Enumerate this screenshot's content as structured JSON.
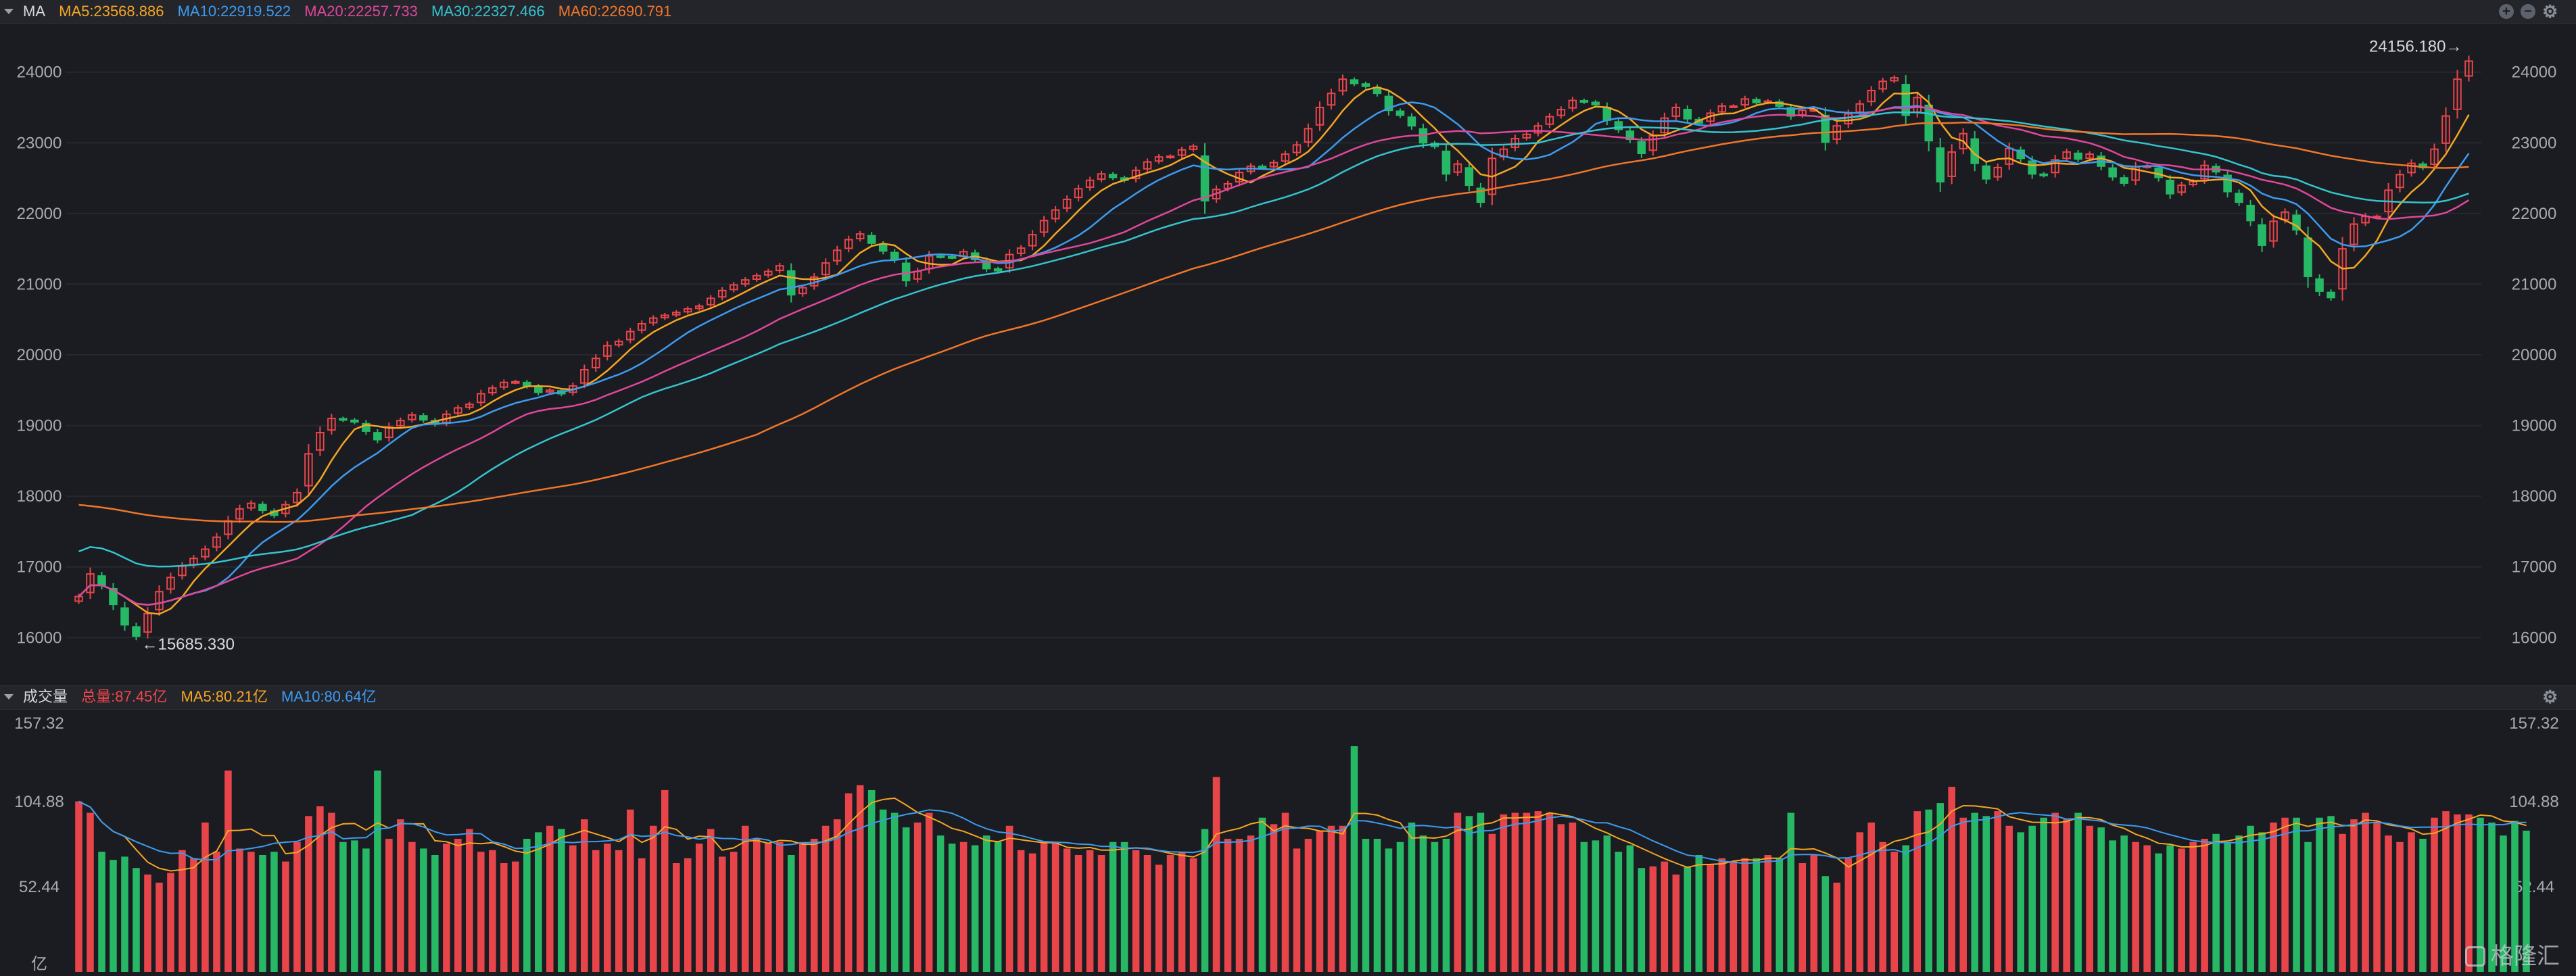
{
  "header": {
    "indicator": "MA",
    "ma": [
      {
        "label": "MA5:23568.886",
        "color": "#f5a623"
      },
      {
        "label": "MA10:22919.522",
        "color": "#3d9bf0"
      },
      {
        "label": "MA20:22257.733",
        "color": "#e0479b"
      },
      {
        "label": "MA30:22327.466",
        "color": "#35c3cf"
      },
      {
        "label": "MA60:22690.791",
        "color": "#f0762a"
      }
    ]
  },
  "volume_header": {
    "title": "成交量",
    "total": {
      "label": "总量:87.45亿",
      "color": "#f0464b"
    },
    "ma": [
      {
        "label": "MA5:80.21亿",
        "color": "#f5a623"
      },
      {
        "label": "MA10:80.64亿",
        "color": "#3d9bf0"
      }
    ]
  },
  "annotations": {
    "high": "24156.180",
    "low": "15685.330"
  },
  "logo": "格隆汇",
  "colors": {
    "up": "#e8454b",
    "down": "#27b866",
    "bg": "#1b1c21",
    "grid": "#26282e"
  },
  "chart_data": [
    {
      "type": "candlestick",
      "title": "MA",
      "ylim": [
        15400,
        24600
      ],
      "yticks": [
        16000,
        17000,
        18000,
        19000,
        20000,
        21000,
        22000,
        23000,
        24000
      ],
      "closes": [
        16580,
        16900,
        16740,
        16470,
        16180,
        16020,
        16340,
        16650,
        16850,
        17010,
        17120,
        17250,
        17420,
        17650,
        17820,
        17900,
        17800,
        17730,
        17880,
        18050,
        18600,
        18900,
        19100,
        19080,
        19050,
        18920,
        18800,
        18980,
        19070,
        19150,
        19080,
        19020,
        19160,
        19250,
        19300,
        19450,
        19530,
        19610,
        19620,
        19560,
        19470,
        19500,
        19450,
        19560,
        19790,
        19950,
        20130,
        20190,
        20330,
        20440,
        20520,
        20560,
        20600,
        20650,
        20690,
        20800,
        20910,
        20990,
        21060,
        21120,
        21180,
        21260,
        20850,
        20950,
        21100,
        21300,
        21480,
        21630,
        21710,
        21580,
        21470,
        21350,
        21050,
        21180,
        21400,
        21390,
        21380,
        21460,
        21350,
        21220,
        21190,
        21420,
        21510,
        21700,
        21900,
        22050,
        22200,
        22350,
        22470,
        22560,
        22510,
        22470,
        22610,
        22730,
        22800,
        22810,
        22900,
        22950,
        22180,
        22340,
        22420,
        22580,
        22670,
        22650,
        22720,
        22840,
        22970,
        23200,
        23500,
        23700,
        23900,
        23840,
        23800,
        23700,
        23460,
        23390,
        23240,
        23000,
        22950,
        22560,
        22700,
        22400,
        22160,
        22780,
        22910,
        23060,
        23120,
        23240,
        23370,
        23470,
        23600,
        23580,
        23540,
        23320,
        23190,
        23050,
        22850,
        23100,
        23350,
        23500,
        23340,
        23280,
        23420,
        23520,
        23520,
        23620,
        23570,
        23590,
        23520,
        23380,
        23460,
        23470,
        23010,
        23240,
        23410,
        23550,
        23740,
        23870,
        23920,
        23390,
        23640,
        23030,
        22450,
        22870,
        23130,
        22710,
        22490,
        22650,
        22920,
        22780,
        22560,
        22540,
        22760,
        22870,
        22770,
        22840,
        22670,
        22520,
        22430,
        22660,
        22670,
        22510,
        22280,
        22400,
        22450,
        22680,
        22590,
        22310,
        22160,
        21900,
        21550,
        21890,
        22020,
        21770,
        21110,
        20900,
        20810,
        21500,
        21850,
        21960,
        21960,
        22330,
        22550,
        22710,
        22650,
        22910,
        23380,
        23900,
        24156
      ],
      "series": [
        {
          "name": "MA5",
          "color": "#f5a623",
          "period": 5
        },
        {
          "name": "MA10",
          "color": "#3d9bf0",
          "period": 10
        },
        {
          "name": "MA20",
          "color": "#e0479b",
          "period": 20
        },
        {
          "name": "MA30",
          "color": "#35c3cf",
          "period": 30
        },
        {
          "name": "MA60",
          "color": "#f0762a",
          "period": 60
        }
      ]
    },
    {
      "type": "bar",
      "title": "成交量",
      "unit": "亿",
      "ylim": [
        0,
        157.32
      ],
      "yticks": [
        {
          "value": 157.32,
          "label": "157.32"
        },
        {
          "value": 104.88,
          "label": "104.88"
        },
        {
          "value": 52.44,
          "label": "52.44"
        },
        {
          "value": 0,
          "label": "亿"
        }
      ],
      "values": [
        105,
        98,
        74,
        69,
        71,
        64,
        60,
        55,
        61,
        75,
        70,
        92,
        74,
        124,
        76,
        74,
        72,
        74,
        68,
        80,
        96,
        102,
        98,
        80,
        81,
        76,
        124,
        82,
        94,
        80,
        76,
        72,
        79,
        82,
        88,
        74,
        75,
        67,
        68,
        82,
        86,
        90,
        88,
        78,
        94,
        75,
        79,
        75,
        100,
        70,
        90,
        112,
        67,
        70,
        79,
        88,
        71,
        74,
        90,
        82,
        79,
        80,
        72,
        80,
        82,
        90,
        94,
        110,
        115,
        112,
        100,
        98,
        89,
        92,
        98,
        84,
        79,
        80,
        78,
        84,
        80,
        90,
        75,
        73,
        80,
        80,
        76,
        72,
        75,
        72,
        80,
        80,
        75,
        72,
        66,
        72,
        74,
        70,
        88,
        120,
        82,
        82,
        84,
        95,
        91,
        98,
        76,
        82,
        87,
        90,
        90,
        139,
        82,
        82,
        76,
        80,
        92,
        84,
        80,
        82,
        98,
        96,
        98,
        85,
        97,
        98,
        98,
        99,
        98,
        91,
        92,
        80,
        81,
        84,
        74,
        78,
        64,
        65,
        68,
        60,
        65,
        72,
        66,
        70,
        68,
        70,
        70,
        72,
        70,
        98,
        67,
        72,
        59,
        55,
        70,
        86,
        92,
        80,
        74,
        78,
        99,
        100,
        104,
        114,
        95,
        98,
        96,
        99,
        90,
        86,
        90,
        95,
        98,
        94,
        98,
        90,
        89,
        81,
        84,
        80,
        78,
        73,
        78,
        76,
        80,
        82,
        85,
        80,
        84,
        90,
        86,
        92,
        95,
        95,
        80,
        95,
        96,
        85,
        94,
        98,
        92,
        84,
        80,
        86,
        82,
        95,
        99,
        97,
        97,
        95,
        92,
        84,
        93,
        87
      ]
    }
  ]
}
